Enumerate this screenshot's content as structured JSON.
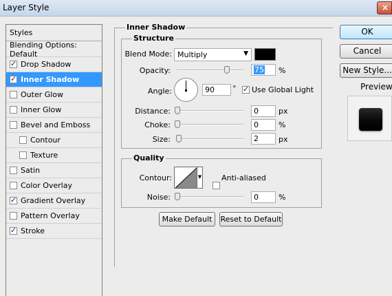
{
  "window": {
    "title": "Layer Style",
    "close_glyph": "×"
  },
  "styles_panel": {
    "header": "Styles",
    "items": [
      {
        "label": "Blending Options: Default",
        "checkbox": false,
        "checked": false,
        "selected": false,
        "sub": false
      },
      {
        "label": "Drop Shadow",
        "checkbox": true,
        "checked": true,
        "selected": false,
        "sub": false
      },
      {
        "label": "Inner Shadow",
        "checkbox": true,
        "checked": true,
        "selected": true,
        "sub": false
      },
      {
        "label": "Outer Glow",
        "checkbox": true,
        "checked": false,
        "selected": false,
        "sub": false
      },
      {
        "label": "Inner Glow",
        "checkbox": true,
        "checked": false,
        "selected": false,
        "sub": false
      },
      {
        "label": "Bevel and Emboss",
        "checkbox": true,
        "checked": false,
        "selected": false,
        "sub": false
      },
      {
        "label": "Contour",
        "checkbox": true,
        "checked": false,
        "selected": false,
        "sub": true
      },
      {
        "label": "Texture",
        "checkbox": true,
        "checked": false,
        "selected": false,
        "sub": true
      },
      {
        "label": "Satin",
        "checkbox": true,
        "checked": false,
        "selected": false,
        "sub": false
      },
      {
        "label": "Color Overlay",
        "checkbox": true,
        "checked": false,
        "selected": false,
        "sub": false
      },
      {
        "label": "Gradient Overlay",
        "checkbox": true,
        "checked": true,
        "selected": false,
        "sub": false
      },
      {
        "label": "Pattern Overlay",
        "checkbox": true,
        "checked": false,
        "selected": false,
        "sub": false
      },
      {
        "label": "Stroke",
        "checkbox": true,
        "checked": true,
        "selected": false,
        "sub": false
      }
    ]
  },
  "inner_shadow": {
    "title": "Inner Shadow",
    "structure": {
      "title": "Structure",
      "blend_mode_label": "Blend Mode:",
      "blend_mode_value": "Multiply",
      "shadow_color": "#000000",
      "opacity_label": "Opacity:",
      "opacity_value": "75",
      "opacity_fraction": 0.75,
      "opacity_unit": "%",
      "angle_label": "Angle:",
      "angle_value": "90",
      "angle_unit": "°",
      "use_global_light_label": "Use Global Light",
      "use_global_light": true,
      "distance_label": "Distance:",
      "distance_value": "0",
      "distance_unit": "px",
      "choke_label": "Choke:",
      "choke_value": "0",
      "choke_unit": "%",
      "size_label": "Size:",
      "size_value": "2",
      "size_unit": "px"
    },
    "quality": {
      "title": "Quality",
      "contour_label": "Contour:",
      "anti_aliased_label": "Anti-aliased",
      "anti_aliased": false,
      "noise_label": "Noise:",
      "noise_value": "0",
      "noise_unit": "%"
    },
    "make_default_label": "Make Default",
    "reset_default_label": "Reset to Default"
  },
  "actions": {
    "ok_label": "OK",
    "cancel_label": "Cancel",
    "new_style_label": "New Style...",
    "preview_label": "Preview",
    "preview_checked": true
  },
  "colors": {
    "selection": "#3399ff",
    "titlebar": "#c5d6ea",
    "background": "#ececec"
  }
}
